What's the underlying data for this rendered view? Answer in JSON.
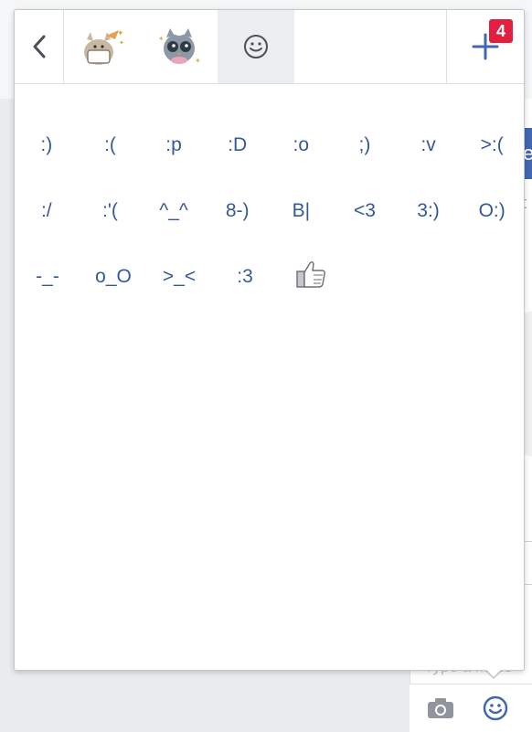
{
  "background": {
    "type_placeholder": "Type a mess",
    "side_letter": "e",
    "side_text": "t"
  },
  "popup": {
    "tabs": [
      {
        "name": "back",
        "icon": "chevron-left-icon"
      },
      {
        "name": "sticker-pack-1",
        "icon": "cat-sticker-icon"
      },
      {
        "name": "sticker-pack-2",
        "icon": "owl-sticker-icon"
      },
      {
        "name": "emoji",
        "icon": "smiley-icon",
        "active": true
      },
      {
        "name": "add",
        "icon": "plus-icon"
      }
    ],
    "badge_count": "4",
    "emoticon_rows": [
      [
        ":)",
        ":(",
        ":p",
        ":D",
        ":o",
        ";)",
        ":v",
        ">:("
      ],
      [
        ":/",
        ":'(",
        "^_^",
        "8-)",
        "B|",
        "<3",
        "3:)",
        "O:)"
      ],
      [
        "-_-",
        "o_O",
        ">_<",
        ":3",
        "like-thumb"
      ]
    ]
  },
  "colors": {
    "emoticon_text": "#365899",
    "accent": "#4267b2",
    "badge": "#e41e3f"
  }
}
